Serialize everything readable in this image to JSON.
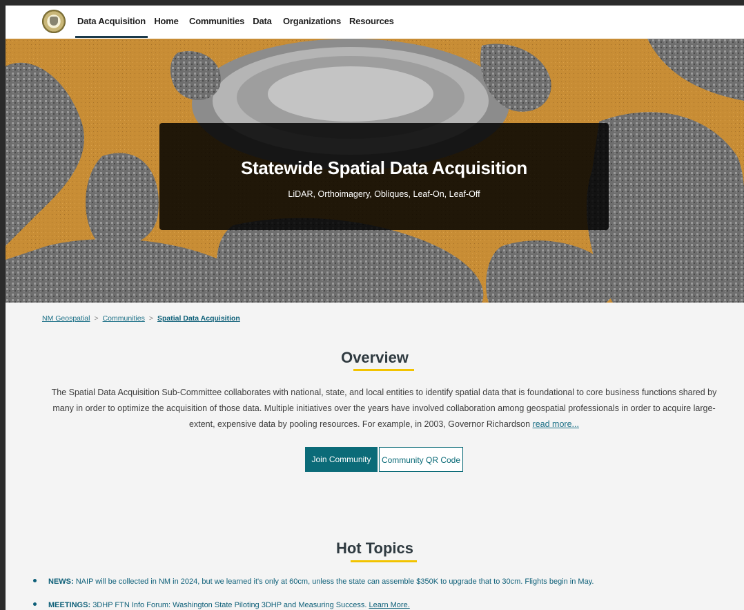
{
  "nav": {
    "items": [
      {
        "label": "Data Acquisition"
      },
      {
        "label": "Home"
      },
      {
        "label": "Communities"
      },
      {
        "label": "Data"
      },
      {
        "label": "Organizations"
      },
      {
        "label": "Resources"
      }
    ]
  },
  "hero": {
    "title": "Statewide Spatial Data Acquisition",
    "subtitle": "LiDAR, Orthoimagery, Obliques, Leaf-On, Leaf-Off"
  },
  "breadcrumb": {
    "items": [
      "NM Geospatial",
      "Communities"
    ],
    "separator": ">",
    "current": "Spatial Data Acquisition"
  },
  "overview": {
    "title": "Overview",
    "text": "The Spatial Data Acquisition Sub-Committee collaborates with national, state, and local entities to identify spatial data that is foundational to core business functions shared by many in order to optimize the acquisition of those data. Multiple initiatives over the years have involved collaboration among geospatial professionals in order to acquire large-extent, expensive data by pooling resources. For example, in 2003, Governor Richardson",
    "read_more": "read more...",
    "join_label": "Join Community",
    "qr_label": "Community QR Code"
  },
  "hot_topics": {
    "title": "Hot Topics",
    "items": [
      {
        "tag": "NEWS:",
        "text": "NAIP will be collected in NM in 2024, but we learned it's only at 60cm, unless the state can assemble $350K to upgrade that to 30cm. Flights begin in May.",
        "link": ""
      },
      {
        "tag": "MEETINGS:",
        "text": "3DHP FTN Info Forum: Washington State Piloting 3DHP and Measuring Success.",
        "link": "Learn More."
      }
    ]
  },
  "colors": {
    "accent": "#0b6b78",
    "underline": "#f2c300",
    "hero_bg": "#c48a32"
  }
}
